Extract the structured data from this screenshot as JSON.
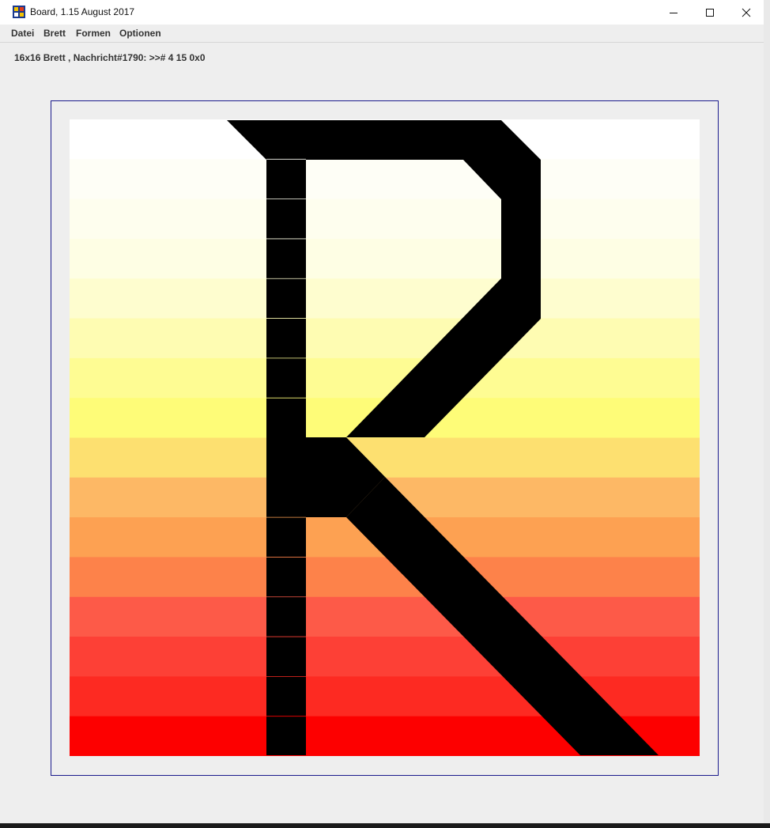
{
  "window": {
    "title": "Board, 1.15 August 2017",
    "icon": "board-app-icon",
    "controls": [
      "minimize-icon",
      "maximize-icon",
      "close-icon"
    ]
  },
  "menubar": {
    "items": [
      {
        "label": "Datei"
      },
      {
        "label": "Brett"
      },
      {
        "label": "Formen"
      },
      {
        "label": "Optionen"
      }
    ]
  },
  "status": {
    "text": "16x16 Brett , Nachricht#1790: >># 4 15 0x0"
  },
  "board": {
    "size": 16,
    "frame_color": "#1a1a8c",
    "rows_visible": 16,
    "row_colors": [
      "#ffffff",
      "#fefef6",
      "#fefeee",
      "#fefee4",
      "#fefdcf",
      "#fefcb2",
      "#fefc93",
      "#fefc78",
      "#fde070",
      "#fdb865",
      "#fda152",
      "#fd824a",
      "#fd5a48",
      "#fd4036",
      "#fd2a22",
      "#fd0000"
    ],
    "symbol": {
      "letter": "R",
      "color": "#000000"
    }
  }
}
